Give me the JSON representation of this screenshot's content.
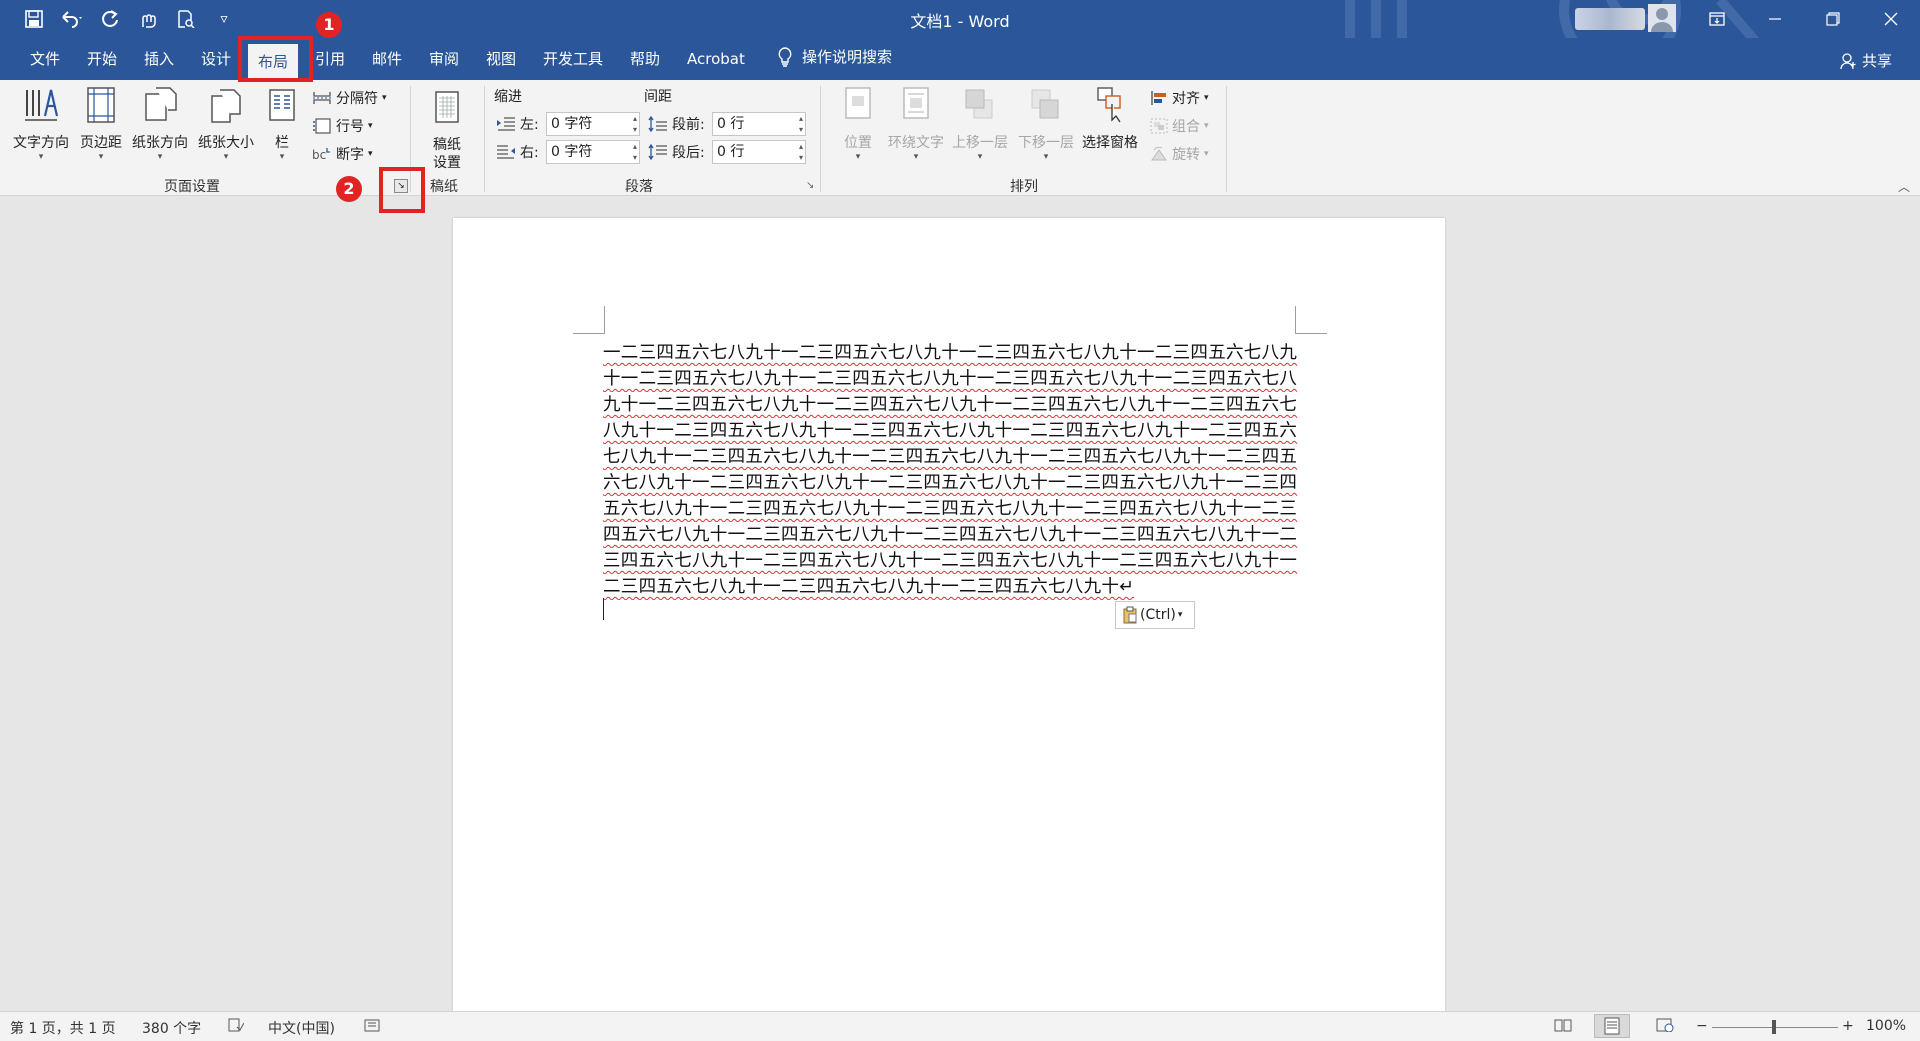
{
  "window": {
    "title": "文档1 - Word",
    "share": "共享"
  },
  "qat": {
    "save_icon": "save-icon",
    "undo_icon": "undo-icon",
    "redo_icon": "redo-icon",
    "customize": "▿"
  },
  "tabs": [
    {
      "label": "文件"
    },
    {
      "label": "开始"
    },
    {
      "label": "插入"
    },
    {
      "label": "设计"
    },
    {
      "label": "布局"
    },
    {
      "label": "引用"
    },
    {
      "label": "邮件"
    },
    {
      "label": "审阅"
    },
    {
      "label": "视图"
    },
    {
      "label": "开发工具"
    },
    {
      "label": "帮助"
    },
    {
      "label": "Acrobat"
    }
  ],
  "search_label": "操作说明搜索",
  "ribbon": {
    "page_setup": {
      "text_direction": "文字方向",
      "margins": "页边距",
      "orientation": "纸张方向",
      "size": "纸张大小",
      "columns": "栏",
      "breaks": "分隔符",
      "line_numbers": "行号",
      "hyphenation": "断字",
      "group_label": "页面设置"
    },
    "manuscript": {
      "button": "稿纸\n设置",
      "group_label": "稿纸"
    },
    "paragraph": {
      "indent_header": "缩进",
      "spacing_header": "间距",
      "left_label": "左:",
      "left_value": "0 字符",
      "right_label": "右:",
      "right_value": "0 字符",
      "before_label": "段前:",
      "before_value": "0 行",
      "after_label": "段后:",
      "after_value": "0 行",
      "group_label": "段落"
    },
    "arrange": {
      "position": "位置",
      "wrap": "环绕文字",
      "forward": "上移一层",
      "backward": "下移一层",
      "selection_pane": "选择窗格",
      "align": "对齐",
      "group": "组合",
      "rotate": "旋转",
      "group_label": "排列"
    }
  },
  "annotations": {
    "badge1": "1",
    "badge2": "2"
  },
  "document": {
    "lines": [
      "一二三四五六七八九十一二三四五六七八九十一二三四五六七八九十一二三四五六七八九",
      "十一二三四五六七八九十一二三四五六七八九十一二三四五六七八九十一二三四五六七八",
      "九十一二三四五六七八九十一二三四五六七八九十一二三四五六七八九十一二三四五六七",
      "八九十一二三四五六七八九十一二三四五六七八九十一二三四五六七八九十一二三四五六",
      "七八九十一二三四五六七八九十一二三四五六七八九十一二三四五六七八九十一二三四五",
      "六七八九十一二三四五六七八九十一二三四五六七八九十一二三四五六七八九十一二三四",
      "五六七八九十一二三四五六七八九十一二三四五六七八九十一二三四五六七八九十一二三",
      "四五六七八九十一二三四五六七八九十一二三四五六七八九十一二三四五六七八九十一二",
      "三四五六七八九十一二三四五六七八九十一二三四五六七八九十一二三四五六七八九十一",
      "二三四五六七八九十一二三四五六七八九十一二三四五六七八九十↵"
    ],
    "paste_options": "(Ctrl)"
  },
  "status": {
    "page": "第 1 页，共 1 页",
    "words": "380 个字",
    "language": "中文(中国)",
    "zoom": "100%"
  },
  "colors": {
    "brand": "#2b579a",
    "annotation": "#e02424"
  }
}
